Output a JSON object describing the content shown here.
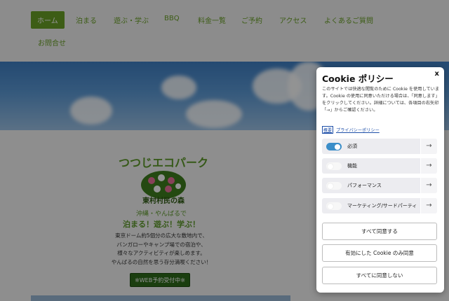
{
  "nav": {
    "items": [
      {
        "label": "ホーム",
        "active": true
      },
      {
        "label": "泊まる"
      },
      {
        "label": "遊ぶ・学ぶ"
      },
      {
        "label": "BBQ"
      },
      {
        "label": "料金一覧"
      },
      {
        "label": "ご予約"
      },
      {
        "label": "アクセス"
      },
      {
        "label": "よくあるご質問"
      },
      {
        "label": "お問合せ"
      }
    ],
    "accent_color": "#6aa026"
  },
  "hero": {
    "logo_text": "つつじエコパーク",
    "logo_subtext": "東村村民の森"
  },
  "intro": {
    "tagline_small": "沖縄・やんばるで",
    "tagline_large": "泊まる！遊ぶ！学ぶ！",
    "desc_lines": [
      "東京ドーム約5個分の広大な敷地内で、",
      "バンガローやキャンプ場での宿泊や、",
      "様々なアクティビティが楽しめます。",
      "やんばるの自然を思う存分満喫ください！"
    ],
    "web_button": "※WEB予約受付中※"
  },
  "cookie": {
    "title": "Cookie ポリシー",
    "close_label": "x",
    "body": "このサイトでは快適な閲覧のために Cookie を使用しています。Cookie の使用に同意いただける場合は、「同意します」をクリックしてください。詳細については、各項目の右矢印「→」からご確認ください。",
    "detail_link": "概要",
    "privacy_link": "プライバシーポリシー",
    "categories": [
      {
        "label": "必須",
        "enabled": true
      },
      {
        "label": "機能",
        "enabled": false
      },
      {
        "label": "パフォーマンス",
        "enabled": false
      },
      {
        "label": "マーケティング/サードパーティ",
        "enabled": false
      }
    ],
    "arrow": "→",
    "buttons": {
      "accept_all": "すべて同意する",
      "accept_selected": "有効にした Cookie のみ同意",
      "reject_all": "すべてに同意しない"
    },
    "toggle_on_color": "#3b8ec9"
  }
}
